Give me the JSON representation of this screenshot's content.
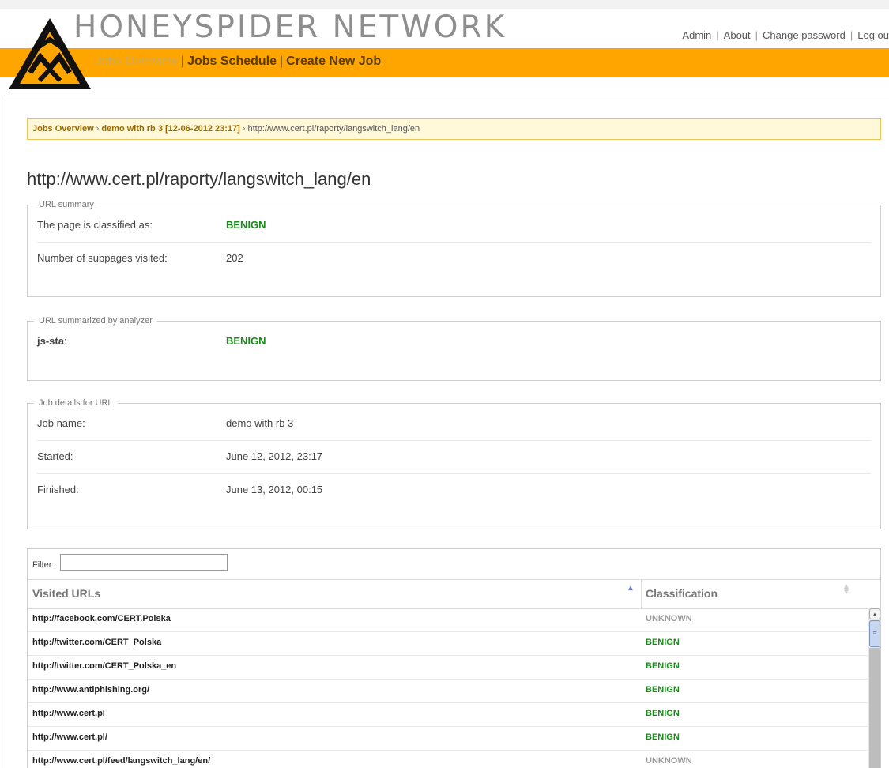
{
  "app": {
    "brand": "HONEYSPIDER NETWORK"
  },
  "top_links": {
    "admin": "Admin",
    "about": "About",
    "change_password": "Change password",
    "logout": "Log ou"
  },
  "nav": {
    "jobs_overview": "Jobs Overview",
    "jobs_schedule": "Jobs Schedule",
    "create_new_job": "Create New Job"
  },
  "breadcrumb": {
    "jobs_overview": "Jobs Overview",
    "job": "demo with rb 3 [12-06-2012 23:17]",
    "current": "http://www.cert.pl/raporty/langswitch_lang/en",
    "separator": "›"
  },
  "page_title": "http://www.cert.pl/raporty/langswitch_lang/en",
  "url_summary": {
    "legend": "URL summary",
    "classified_label": "The page is classified as:",
    "classified_value": "BENIGN",
    "subpages_label": "Number of subpages visited:",
    "subpages_value": "202"
  },
  "analyzer_summary": {
    "legend": "URL summarized by analyzer",
    "analyzer_name": "js-sta",
    "analyzer_suffix": ":",
    "analyzer_value": "BENIGN"
  },
  "job_details": {
    "legend": "Job details for URL",
    "name_label": "Job name:",
    "name_value": "demo with rb 3",
    "started_label": "Started:",
    "started_value": "June 12, 2012, 23:17",
    "finished_label": "Finished:",
    "finished_value": "June 13, 2012, 00:15"
  },
  "table": {
    "filter_label": "Filter:",
    "filter_value": "",
    "headers": {
      "url": "Visited URLs",
      "classification": "Classification"
    },
    "rows": [
      {
        "url": "http://facebook.com/CERT.Polska",
        "classification": "UNKNOWN"
      },
      {
        "url": "http://twitter.com/CERT_Polska",
        "classification": "BENIGN"
      },
      {
        "url": "http://twitter.com/CERT_Polska_en",
        "classification": "BENIGN"
      },
      {
        "url": "http://www.antiphishing.org/",
        "classification": "BENIGN"
      },
      {
        "url": "http://www.cert.pl",
        "classification": "BENIGN"
      },
      {
        "url": "http://www.cert.pl/",
        "classification": "BENIGN"
      },
      {
        "url": "http://www.cert.pl/feed/langswitch_lang/en/",
        "classification": "UNKNOWN"
      }
    ]
  },
  "colors": {
    "accent_orange": "#ffa500",
    "benign_green": "#1a8a1a",
    "unknown_gray": "#9a9a9a",
    "breadcrumb_bg": "#fff9d9"
  },
  "icons": {
    "logo": "honeyspider-triangle-logo",
    "sort_asc": "sort-ascending-icon",
    "sort_both": "sort-both-icon"
  }
}
